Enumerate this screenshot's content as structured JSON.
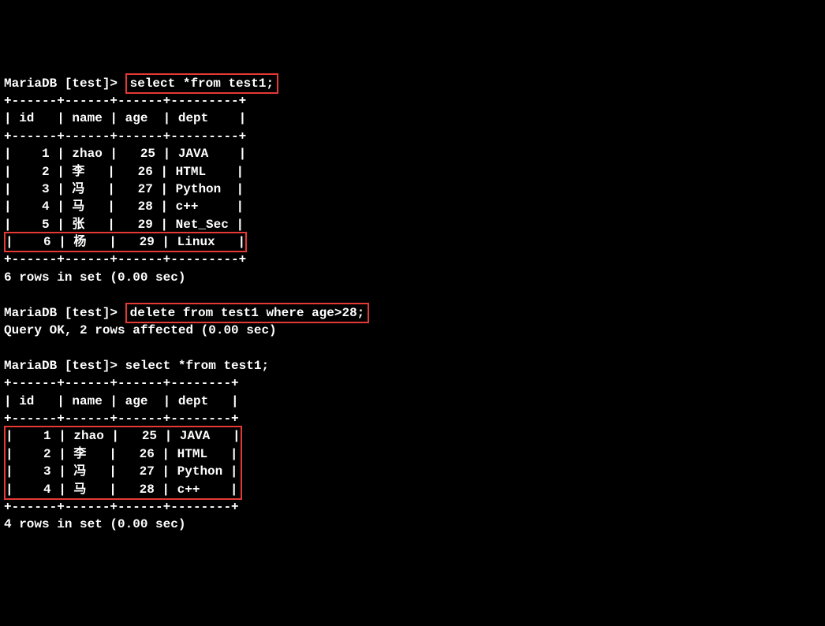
{
  "prompt": "MariaDB [test]> ",
  "cmd1": "select *from test1;",
  "cmd2": "delete from test1 where age>28;",
  "cmd3": "select *from test1;",
  "result1_footer": "6 rows in set (0.00 sec)",
  "result2": "Query OK, 2 rows affected (0.00 sec)",
  "result3_footer": "4 rows in set (0.00 sec)",
  "table1": {
    "divider": "+------+------+------+---------+",
    "header": "| id   | name | age  | dept    |",
    "rows": [
      "|    1 | zhao |   25 | JAVA    |",
      "|    2 | 李   |   26 | HTML    |",
      "|    3 | 冯   |   27 | Python  |",
      "|    4 | 马   |   28 | c++     |",
      "|    5 | 张   |   29 | Net_Sec |",
      "|    6 | 杨   |   29 | Linux   |"
    ]
  },
  "table2": {
    "divider": "+------+------+------+--------+",
    "header": "| id   | name | age  | dept   |",
    "rows": [
      "|    1 | zhao |   25 | JAVA   |",
      "|    2 | 李   |   26 | HTML   |",
      "|    3 | 冯   |   27 | Python |",
      "|    4 | 马   |   28 | c++    |"
    ]
  }
}
